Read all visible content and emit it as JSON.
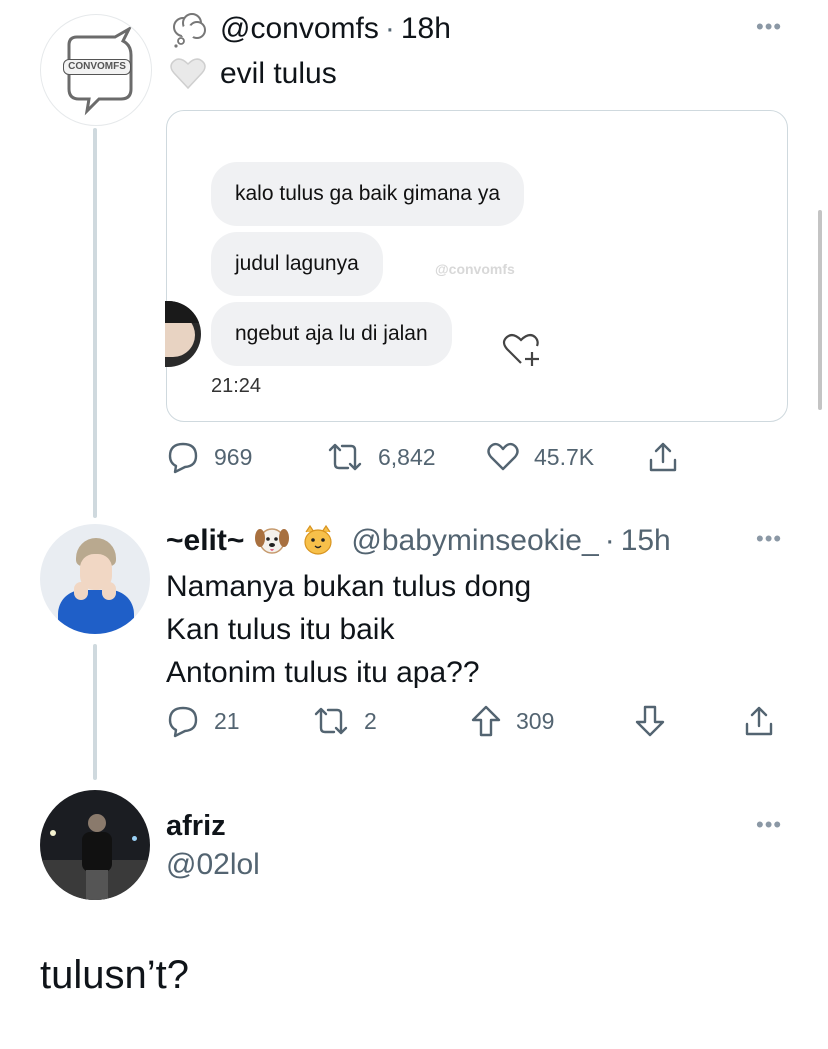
{
  "tweet1": {
    "username": "@convomfs",
    "time": "18h",
    "separator": "·",
    "text": "evil tulus",
    "avatar_label": "CONVOMFS",
    "emoji_thought": "thought-balloon",
    "emoji_heart": "white-heart",
    "embed": {
      "bubbles": [
        "kalo tulus ga baik gimana ya",
        "judul lagunya",
        "ngebut aja lu di jalan"
      ],
      "watermark": "@convomfs",
      "timestamp": "21:24"
    },
    "actions": {
      "replies": "969",
      "retweets": "6,842",
      "likes": "45.7K"
    }
  },
  "tweet2": {
    "display_name": "~elit~",
    "emojis": [
      "dog-face",
      "cat-face"
    ],
    "username": "@babyminseokie_",
    "separator": "·",
    "time": "15h",
    "lines": [
      "Namanya bukan tulus dong",
      "Kan tulus itu baik",
      "Antonim tulus itu apa??"
    ],
    "actions": {
      "replies": "21",
      "retweets": "2",
      "upvotes": "309"
    }
  },
  "tweet3": {
    "display_name": "afriz",
    "username": "@02lol",
    "text": "tulusn’t?"
  },
  "colors": {
    "text": "#0f1419",
    "secondary": "#536471",
    "border": "#cfd9de",
    "bubble": "#f0f1f3"
  }
}
